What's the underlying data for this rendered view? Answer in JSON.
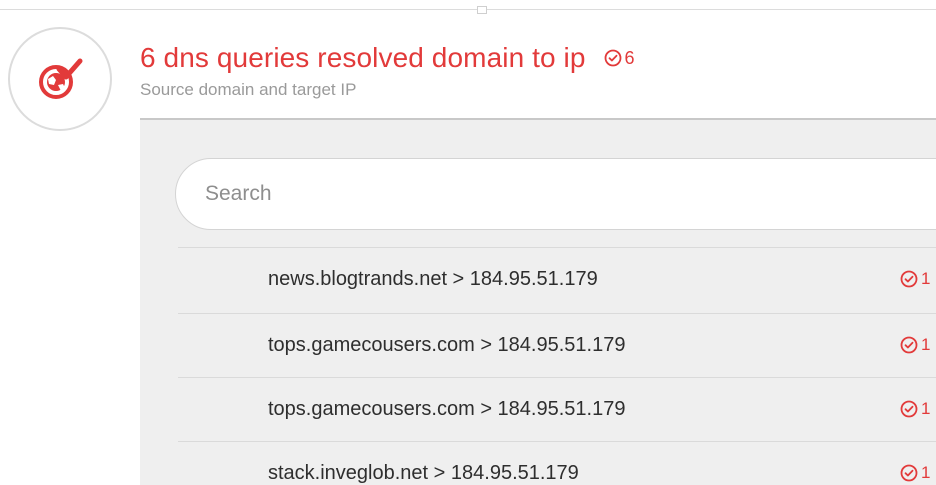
{
  "header": {
    "title": "6 dns queries resolved domain to ip",
    "count": "6",
    "subtitle": "Source domain and target IP",
    "icon": "dns-resolve-check-icon",
    "accent_color": "#e23a3a"
  },
  "search": {
    "placeholder": "Search",
    "value": ""
  },
  "results": [
    {
      "label": "news.blogtrands.net > 184.95.51.179",
      "count": "1"
    },
    {
      "label": "tops.gamecousers.com > 184.95.51.179",
      "count": "1"
    },
    {
      "label": "tops.gamecousers.com > 184.95.51.179",
      "count": "1"
    },
    {
      "label": "stack.inveglob.net > 184.95.51.179",
      "count": "1"
    }
  ]
}
